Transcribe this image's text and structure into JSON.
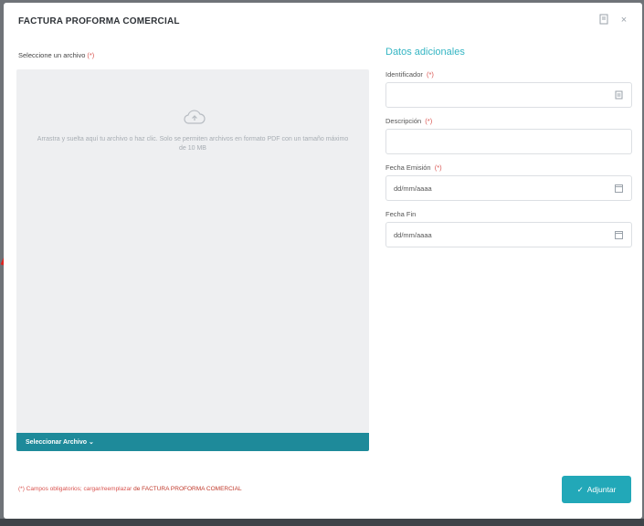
{
  "modal": {
    "title": "FACTURA PROFORMA COMERCIAL",
    "header_icons": [
      "document-icon",
      "close-icon"
    ]
  },
  "upload": {
    "label": "Seleccione un archivo",
    "required_mark": "(*)",
    "dropzone_text": "Arrastra y suelta aquí tu archivo o haz clic. Solo se permiten archivos en formato PDF con un tamaño máximo de 10 MB",
    "select_button_label": "Seleccionar Archivo ⌄"
  },
  "details": {
    "section_title": "Datos adicionales",
    "fields": [
      {
        "label": "Identificador",
        "required": "(*)",
        "value": "",
        "icon": "list-icon"
      },
      {
        "label": "Descripción",
        "required": "(*)",
        "value": "",
        "icon": ""
      },
      {
        "label": "Fecha Emisión",
        "required": "(*)",
        "value": "dd/mm/aaaa",
        "icon": "calendar-icon"
      },
      {
        "label": "Fecha Fin",
        "required": "",
        "value": "dd/mm/aaaa",
        "icon": "calendar-icon"
      }
    ]
  },
  "footer": {
    "note": "(*) Campos obligatorios; cargar/reemplazar",
    "note_link": "de FACTURA PROFORMA COMERCIAL",
    "submit_label": "Adjuntar",
    "submit_icon": "check-icon"
  },
  "colors": {
    "accent": "#22a8b8",
    "select_button": "#1e8a9a",
    "section_title": "#34b5c3",
    "required": "#d9534f"
  }
}
